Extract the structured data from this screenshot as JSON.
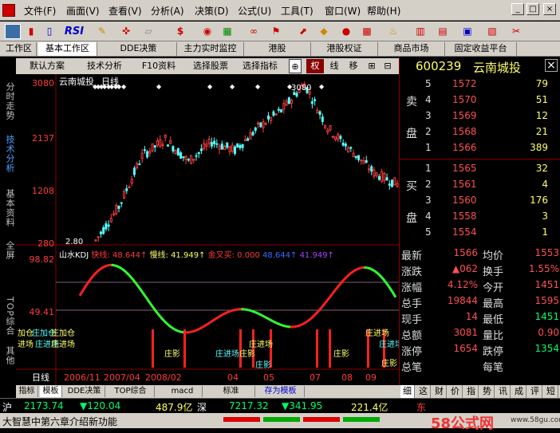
{
  "menu": [
    "文件(F)",
    "画面(V)",
    "查看(V)",
    "分析(A)",
    "决策(D)",
    "公式(U)",
    "工具(T)",
    "窗口(W)",
    "帮助(H)"
  ],
  "window_controls": {
    "min": "_",
    "max": "□",
    "close": "×"
  },
  "toolbar": {
    "rsi": "RSI",
    "dollar": "$"
  },
  "top_tabs": [
    "工作区",
    "基本工作区",
    "DDE决策",
    "主力实时监控",
    "港股",
    "港股权证",
    "商品市场",
    "固定收益平台"
  ],
  "sub_tabs": [
    "默认方案",
    "技术分析",
    "F10资料",
    "选择股票",
    "选择指标",
    "权",
    "线",
    "移"
  ],
  "left_side": [
    "分时走势",
    "技术分析",
    "基本资料",
    "全屏",
    "TOP综合",
    "其他"
  ],
  "chart": {
    "stock_name": "云南城投",
    "period": "日线",
    "y_labels": [
      "3080",
      "2137",
      "1208",
      "280"
    ],
    "high_label": "3080",
    "low_label": "2.80",
    "ind_title": "山水KDJ",
    "ind_fast": "快线: 48.644↑",
    "ind_slow": "慢线: 41.949↑",
    "ind_golden": "金叉买: 0.000",
    "ind_v1": "48.644↑",
    "ind_v2": "41.949↑",
    "ind_y_labels": [
      "98.82",
      "49.41"
    ],
    "signals": [
      "加仓",
      "庄加仓",
      "庄加仓",
      "进场",
      "庄进场",
      "庄进场",
      "庄影",
      "庄进场",
      "庄影",
      "庄进场",
      "庄影",
      "庄影",
      "庄进场",
      "庄进场",
      "庄影"
    ],
    "date_axis": [
      "日线",
      "2006/11",
      "2007/04",
      "2008/02",
      "04",
      "05",
      "07",
      "08",
      "09"
    ]
  },
  "chart_data": {
    "type": "candlestick",
    "title": "云南城投 日线",
    "ylabel": "",
    "ylim": [
      280,
      3080
    ],
    "y_ticks": [
      3080,
      2137,
      1208,
      280
    ],
    "close_estimates": [
      300,
      900,
      1800,
      2100,
      1700,
      2050,
      1900,
      2300,
      2600,
      3080,
      2300,
      1900,
      1500,
      1300
    ]
  },
  "stock": {
    "code": "600239",
    "name": "云南城投",
    "close": "×"
  },
  "sell_orders": [
    {
      "label": "",
      "level": "5",
      "price": "1572",
      "vol": "79"
    },
    {
      "label": "卖",
      "level": "4",
      "price": "1570",
      "vol": "51"
    },
    {
      "label": "",
      "level": "3",
      "price": "1569",
      "vol": "12"
    },
    {
      "label": "盘",
      "level": "2",
      "price": "1568",
      "vol": "21"
    },
    {
      "label": "",
      "level": "1",
      "price": "1566",
      "vol": "389"
    }
  ],
  "buy_orders": [
    {
      "label": "",
      "level": "1",
      "price": "1565",
      "vol": "32"
    },
    {
      "label": "买",
      "level": "2",
      "price": "1561",
      "vol": "4"
    },
    {
      "label": "",
      "level": "3",
      "price": "1560",
      "vol": "176"
    },
    {
      "label": "盘",
      "level": "4",
      "price": "1558",
      "vol": "3"
    },
    {
      "label": "",
      "level": "5",
      "price": "1554",
      "vol": "1"
    }
  ],
  "stats": [
    [
      "最新",
      "1566",
      "均价",
      "1553"
    ],
    [
      "涨跌",
      "▲062",
      "换手",
      "1.55%"
    ],
    [
      "涨幅",
      "4.12%",
      "今开",
      "1451"
    ],
    [
      "总手",
      "19844",
      "最高",
      "1595"
    ],
    [
      "现手",
      "14",
      "最低",
      "1451"
    ],
    [
      "总额",
      "3081",
      "量比",
      "0.90"
    ],
    [
      "涨停",
      "1654",
      "跌停",
      "1354"
    ],
    [
      "总笔",
      "",
      "每笔",
      ""
    ]
  ],
  "bottom_tabs": [
    "指标",
    "模板",
    "DDE决策",
    "TOP综合",
    "macd",
    "标准",
    "存为模板"
  ],
  "right_tabs": [
    "细",
    "这",
    "财",
    "价",
    "指",
    "势",
    "讯",
    "成",
    "评",
    "短"
  ],
  "status": {
    "sh_label": "沪",
    "sh_index": "2173.74",
    "sh_change": "▼120.04",
    "sh_amount": "487.9亿",
    "sz_label": "深",
    "sz_index": "7217.32",
    "sz_change": "▼341.95",
    "sz_amount": "221.4亿",
    "east": "东"
  },
  "footer": {
    "text": "大智慧中第六章介绍新功能",
    "watermark": "58公式网",
    "url": "www.58gu.com"
  }
}
